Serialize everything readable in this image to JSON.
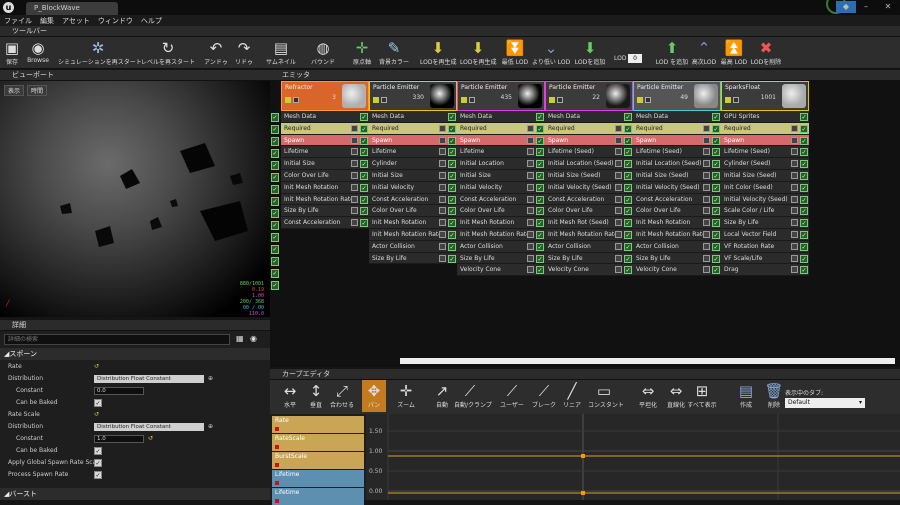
{
  "app": {
    "doc_tab": "P_BlockWave"
  },
  "menu": [
    "ファイル",
    "編集",
    "アセット",
    "ウィンドウ",
    "ヘルプ"
  ],
  "toolbar": {
    "title": "ツールバー",
    "buttons": [
      {
        "label": "保存",
        "icon": "save-icon"
      },
      {
        "label": "Browse",
        "icon": "browse-icon"
      },
      {
        "label": "シミュレーションを再スタート",
        "icon": "restart-sim-icon"
      },
      {
        "label": "レベルを再スタート",
        "icon": "restart-level-icon"
      },
      {
        "label": "アンドゥ",
        "icon": "undo-icon"
      },
      {
        "label": "リドゥ",
        "icon": "redo-icon"
      },
      {
        "label": "サムネイル",
        "icon": "thumbnail-icon"
      },
      {
        "label": "バウンド",
        "icon": "bounds-icon"
      },
      {
        "label": "原点軸",
        "icon": "origin-axis-icon"
      },
      {
        "label": "背景カラー",
        "icon": "background-color-icon"
      },
      {
        "label": "LODを再生成",
        "icon": "regen-lod-icon"
      },
      {
        "label": "LODを再生成",
        "icon": "regen-lod-icon"
      },
      {
        "label": "最低 LOD",
        "icon": "lowest-lod-icon"
      },
      {
        "label": "より低い LOD",
        "icon": "lower-lod-icon"
      },
      {
        "label": "LODを追加",
        "icon": "add-lod-icon"
      },
      {
        "label": "LOD を追加",
        "icon": "add-lod-icon"
      },
      {
        "label": "高次LOD",
        "icon": "higher-lod-icon"
      },
      {
        "label": "最高 LOD",
        "icon": "highest-lod-icon"
      },
      {
        "label": "LODを削除",
        "icon": "delete-lod-icon"
      }
    ],
    "lod_label": "LOD",
    "lod_value": "0"
  },
  "viewport": {
    "title": "ビューポート",
    "btn_view": "表示",
    "btn_time": "時間",
    "stats": [
      "880/1001",
      "0.19",
      "1.00",
      "200/ 368",
      "00 / 00",
      "110.0"
    ]
  },
  "details": {
    "title": "詳細",
    "search_placeholder": "詳細の検索",
    "sections": [
      {
        "name": "スポーン",
        "rows": [
          {
            "k": "Rate",
            "type": "none"
          },
          {
            "k": "Distribution",
            "type": "dropdown",
            "v": "Distribution Float Constant"
          },
          {
            "k": "Constant",
            "type": "num",
            "v": "0.0"
          },
          {
            "k": "Can be Baked",
            "type": "check"
          },
          {
            "k": "Rate Scale",
            "type": "none"
          },
          {
            "k": "Distribution",
            "type": "dropdown",
            "v": "Distribution Float Constant"
          },
          {
            "k": "Constant",
            "type": "num",
            "v": "1.0"
          },
          {
            "k": "Can be Baked",
            "type": "check"
          },
          {
            "k": "Apply Global Spawn Rate Scale",
            "type": "check"
          },
          {
            "k": "Process Spawn Rate",
            "type": "check"
          }
        ]
      },
      {
        "name": "バースト",
        "rows": []
      }
    ]
  },
  "emitters": {
    "title": "エミッタ",
    "columns": [
      {
        "name": "Refractor",
        "count": "3",
        "hdr": "#d9652a",
        "border": "#ff9933",
        "thumb": "#b0b0b0",
        "modules": [
          "Mesh Data",
          "Required",
          "Spawn",
          "Lifetime",
          "Initial Size",
          "Color Over Life",
          "Init Mesh Rotation",
          "Init Mesh Rotation Rate",
          "Size By Life",
          "Const Acceleration"
        ]
      },
      {
        "name": "Particle Emitter",
        "count": "330",
        "hdr": "#3b3b3b",
        "border": "#e6c800",
        "thumb": "#000000",
        "modules": [
          "Mesh Data",
          "Required",
          "Spawn",
          "Lifetime",
          "Cylinder",
          "Initial Size",
          "Initial Velocity",
          "Const Acceleration",
          "Color Over Life",
          "Init Mesh Rotation",
          "Init Mesh Rotation Rate",
          "Actor Collision",
          "Size By Life"
        ]
      },
      {
        "name": "Particle Emitter",
        "count": "435",
        "hdr": "#3b3b3b",
        "border": "#e040e0",
        "thumb": "#000000",
        "modules": [
          "Mesh Data",
          "Required",
          "Spawn",
          "Lifetime",
          "Initial Location",
          "Initial Size",
          "Initial Velocity",
          "Const Acceleration",
          "Color Over Life",
          "Init Mesh Rotation",
          "Init Mesh Rotation Rate",
          "Actor Collision",
          "Size By Life",
          "Velocity Cone"
        ]
      },
      {
        "name": "Particle Emitter",
        "count": "22",
        "hdr": "#3b3b3b",
        "border": "#e040e0",
        "thumb": "#1a1a1a",
        "modules": [
          "Mesh Data",
          "Required",
          "Spawn",
          "Lifetime (Seed)",
          "Initial Location (Seed)",
          "Initial Size (Seed)",
          "Initial Velocity (Seed)",
          "Const Acceleration",
          "Color Over Life",
          "Init Mesh Rot (Seed)",
          "Init Mesh Rotation Rate",
          "Actor Collision",
          "Size By Life",
          "Velocity Cone"
        ]
      },
      {
        "name": "Particle Emitter",
        "count": "49",
        "hdr": "#555555",
        "border": "#40d0d0",
        "thumb": "#888888",
        "modules": [
          "Mesh Data",
          "Required",
          "Spawn",
          "Lifetime (Seed)",
          "Initial Location (Seed)",
          "Initial Size (Seed)",
          "Initial Velocity (Seed)",
          "Const Acceleration",
          "Color Over Life",
          "Init Mesh Rotation",
          "Init Mesh Rotation Rate",
          "Actor Collision",
          "Size By Life",
          "Velocity Cone"
        ]
      },
      {
        "name": "SparksFloat",
        "count": "1001",
        "hdr": "#3b3b3b",
        "border": "#e6c800",
        "thumb": "#aaaaaa",
        "modules": [
          "GPU Sprites",
          "Required",
          "Spawn",
          "Lifetime (Seed)",
          "Cylinder (Seed)",
          "Initial Size (Seed)",
          "Init Color (Seed)",
          "Initial Velocity (Seed)",
          "Scale Color / Life",
          "Size By Life",
          "Local Vector Field",
          "VF Rotation Rate",
          "VF Scale/Life",
          "Drag"
        ]
      }
    ]
  },
  "curve_editor": {
    "title": "カーブエディタ",
    "buttons": [
      {
        "label": "水平",
        "icon": "fit-horizontal-icon"
      },
      {
        "label": "垂直",
        "icon": "fit-vertical-icon"
      },
      {
        "label": "合わせる",
        "icon": "fit-all-icon"
      },
      {
        "label": "パン",
        "icon": "pan-icon"
      },
      {
        "label": "ズーム",
        "icon": "zoom-icon"
      },
      {
        "label": "自動",
        "icon": "auto-tangent-icon"
      },
      {
        "label": "自動/クランプ",
        "icon": "auto-clamp-icon"
      },
      {
        "label": "ユーザー",
        "icon": "user-tangent-icon"
      },
      {
        "label": "ブレーク",
        "icon": "break-tangent-icon"
      },
      {
        "label": "リニア",
        "icon": "linear-icon"
      },
      {
        "label": "コンスタント",
        "icon": "constant-icon"
      },
      {
        "label": "平坦化",
        "icon": "flatten-icon"
      },
      {
        "label": "直線化",
        "icon": "straighten-icon"
      },
      {
        "label": "すべて表示",
        "icon": "show-all-icon"
      },
      {
        "label": "作成",
        "icon": "create-icon"
      },
      {
        "label": "削除",
        "icon": "delete-icon"
      }
    ],
    "tab_label": "表示中のタブ:",
    "tab_select": "Default",
    "tracks": [
      "Rate",
      "RateScale",
      "BurstScale",
      "Lifetime",
      "Lifetime"
    ],
    "y_ticks": [
      "1.50",
      "1.00",
      "0.50",
      "0.00"
    ]
  }
}
